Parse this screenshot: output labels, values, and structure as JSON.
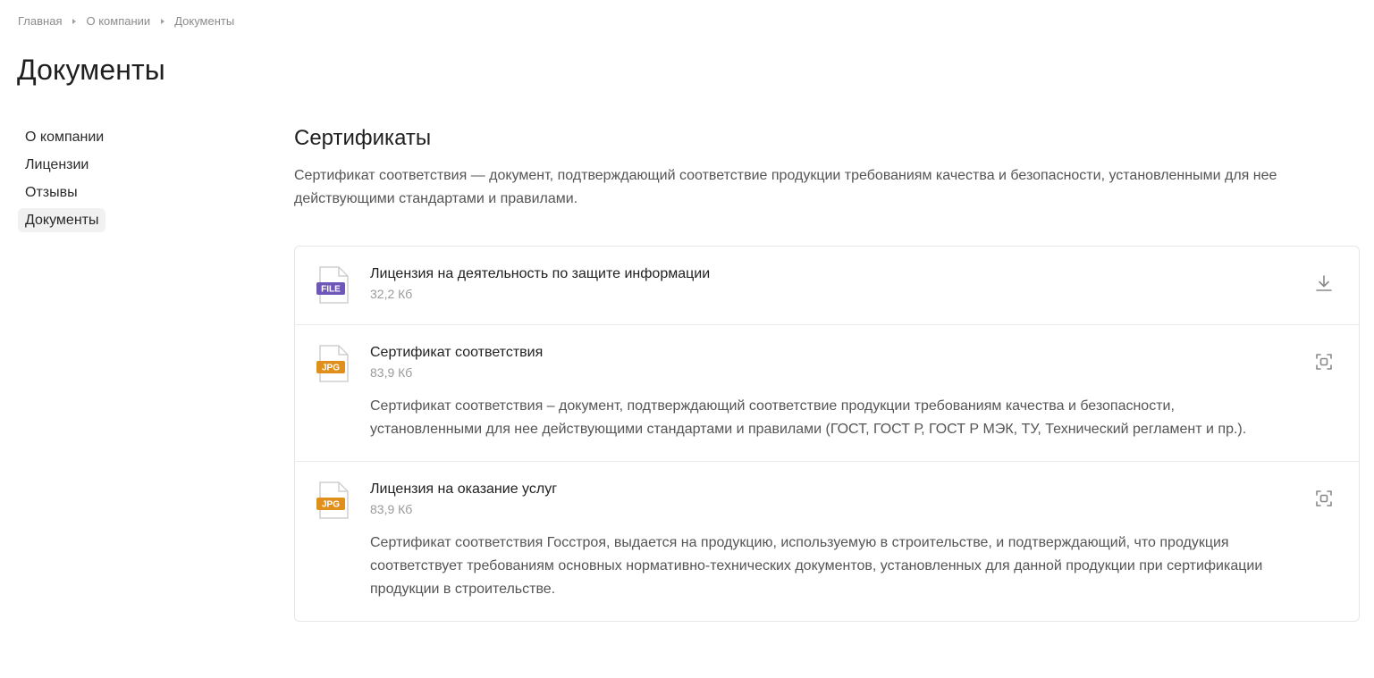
{
  "breadcrumb": [
    {
      "label": "Главная"
    },
    {
      "label": "О компании"
    },
    {
      "label": "Документы"
    }
  ],
  "page_title": "Документы",
  "sidebar": {
    "items": [
      {
        "label": "О компании",
        "active": false
      },
      {
        "label": "Лицензии",
        "active": false
      },
      {
        "label": "Отзывы",
        "active": false
      },
      {
        "label": "Документы",
        "active": true
      }
    ]
  },
  "section": {
    "title": "Сертификаты",
    "description": "Сертификат соответствия — документ, подтверждающий соответствие продукции требованиям качества и безопасности, установленными для нее действующими стандартами и правилами."
  },
  "documents": [
    {
      "name": "Лицензия на деятельность по защите информации",
      "size": "32,2 Кб",
      "type_label": "FILE",
      "type_color": "#6e57b8",
      "action_icon": "download-icon",
      "description": ""
    },
    {
      "name": "Сертификат соответствия",
      "size": "83,9 Кб",
      "type_label": "JPG",
      "type_color": "#e0901a",
      "action_icon": "zoom-preview-icon",
      "description": "Сертификат соответствия – документ, подтверждающий соответствие продукции требованиям качества и безопасности, установленными для нее действующими стандартами и правилами (ГОСТ, ГОСТ Р, ГОСТ Р МЭК, ТУ, Технический регламент и пр.)."
    },
    {
      "name": "Лицензия на оказание услуг",
      "size": "83,9 Кб",
      "type_label": "JPG",
      "type_color": "#e0901a",
      "action_icon": "zoom-preview-icon",
      "description": "Сертификат соответствия Госстроя, выдается на продукцию, используемую в строительстве, и подтверждающий, что продукция соответствует требованиям основных нормативно-технических документов, установленных для данной продукции при сертификации продукции в строительстве."
    }
  ]
}
